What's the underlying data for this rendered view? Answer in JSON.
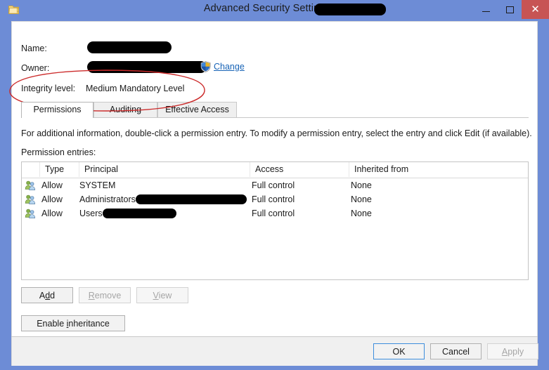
{
  "window": {
    "title": "Advanced Security Settings for",
    "title_redacted": true,
    "icon": "folder-icon",
    "controls": {
      "minimize": "Minimize",
      "maximize": "Maximize",
      "close": "Close"
    },
    "titlebar_color": "#6d8cd6",
    "close_color": "#c75454"
  },
  "header": {
    "name_label": "Name:",
    "name_value_redacted": true,
    "owner_label": "Owner:",
    "owner_value_redacted": true,
    "change_link": "Change",
    "change_icon": "uac-shield-icon",
    "integrity_label": "Integrity level:",
    "integrity_value": "Medium Mandatory Level"
  },
  "annotation": {
    "type": "hand-drawn-ellipse",
    "color": "#cc2b2b",
    "target": "integrity-level-row"
  },
  "tabs": [
    {
      "id": "permissions",
      "label": "Permissions",
      "active": true
    },
    {
      "id": "auditing",
      "label": "Auditing",
      "active": false
    },
    {
      "id": "effective",
      "label": "Effective Access",
      "active": false
    }
  ],
  "permissions_page": {
    "info_text": "For additional information, double-click a permission entry. To modify a permission entry, select the entry and click Edit (if available).",
    "entries_label": "Permission entries:",
    "columns": [
      "",
      "Type",
      "Principal",
      "Access",
      "Inherited from"
    ],
    "rows": [
      {
        "icon": "group-users-icon",
        "type": "Allow",
        "principal_prefix": "SYSTEM",
        "principal_redaction_width": 0,
        "access": "Full control",
        "inherited_from": "None"
      },
      {
        "icon": "group-users-icon",
        "type": "Allow",
        "principal_prefix": "Administrators",
        "principal_redaction_width": 158,
        "access": "Full control",
        "inherited_from": "None"
      },
      {
        "icon": "group-users-icon",
        "type": "Allow",
        "principal_prefix": "Users",
        "principal_redaction_width": 105,
        "access": "Full control",
        "inherited_from": "None"
      }
    ],
    "buttons": {
      "add": "Add",
      "add_accel": "d",
      "remove": "Remove",
      "remove_accel": "R",
      "remove_enabled": false,
      "view": "View",
      "view_accel": "V",
      "view_enabled": false,
      "inheritance": "Enable inheritance",
      "inheritance_accel": "i"
    }
  },
  "footer": {
    "ok": "OK",
    "cancel": "Cancel",
    "apply": "Apply",
    "apply_accel": "A",
    "apply_enabled": false,
    "focused": "ok"
  }
}
